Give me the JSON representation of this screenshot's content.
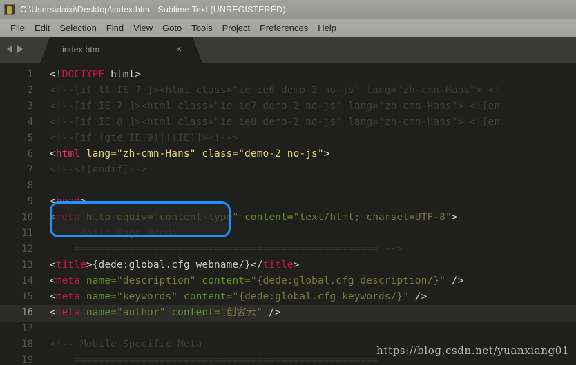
{
  "window": {
    "title": "C:\\Users\\daixi\\Desktop\\index.htm - Sublime Text (UNREGISTERED)",
    "icon": "sublime-text-icon"
  },
  "menubar": {
    "items": [
      {
        "label": "File"
      },
      {
        "label": "Edit"
      },
      {
        "label": "Selection"
      },
      {
        "label": "Find"
      },
      {
        "label": "View"
      },
      {
        "label": "Goto"
      },
      {
        "label": "Tools"
      },
      {
        "label": "Project"
      },
      {
        "label": "Preferences"
      },
      {
        "label": "Help"
      }
    ]
  },
  "tabbar": {
    "prev_icon": "arrow-left-icon",
    "next_icon": "arrow-right-icon",
    "tab": {
      "label": "index.htm",
      "close_label": "×"
    }
  },
  "editor": {
    "active_line": 16,
    "highlight_color": "#1e90ff",
    "lines": [
      {
        "num": "1",
        "segments": [
          {
            "t": "<!",
            "c": "c-punct"
          },
          {
            "t": "DOCTYPE",
            "c": "c-doctype"
          },
          {
            "t": " html>",
            "c": "c-punct"
          }
        ]
      },
      {
        "num": "2",
        "segments": [
          {
            "t": "<!--[if lt IE 7 ]><html class=\"ie ie6 demo-2 no-js\" lang=\"zh-cmn-Hans\"> <!",
            "c": "c-comment"
          }
        ]
      },
      {
        "num": "3",
        "segments": [
          {
            "t": "<!--[if IE 7 ]><html class=\"ie ie7 demo-2 no-js\" lang=\"zh-cmn-Hans\"> <![en",
            "c": "c-comment"
          }
        ]
      },
      {
        "num": "4",
        "segments": [
          {
            "t": "<!--[if IE 8 ]><html class=\"ie ie8 demo-2 no-js\" lang=\"zh-cmn-Hans\"> <![en",
            "c": "c-comment"
          }
        ]
      },
      {
        "num": "5",
        "segments": [
          {
            "t": "<!--[if (gte IE 9)|!(IE)]><!-->",
            "c": "c-comment"
          }
        ]
      },
      {
        "num": "6",
        "highlighted": true,
        "segments": [
          {
            "t": "<",
            "c": "c-punct"
          },
          {
            "t": "html",
            "c": "c-tag"
          },
          {
            "t": " lang=",
            "c": "c-attr"
          },
          {
            "t": "\"zh-cmn-Hans\"",
            "c": "c-string"
          },
          {
            "t": " class=",
            "c": "c-attr"
          },
          {
            "t": "\"demo-2 no-js\"",
            "c": "c-string"
          },
          {
            "t": ">",
            "c": "c-punct"
          }
        ]
      },
      {
        "num": "7",
        "segments": [
          {
            "t": "<!--<![endif]-->",
            "c": "c-comment"
          }
        ]
      },
      {
        "num": "8",
        "segments": []
      },
      {
        "num": "9",
        "segments": [
          {
            "t": "<",
            "c": "c-punct"
          },
          {
            "t": "head",
            "c": "c-tag"
          },
          {
            "t": ">",
            "c": "c-punct"
          }
        ]
      },
      {
        "num": "10",
        "segments": [
          {
            "t": "<",
            "c": "c-punct"
          },
          {
            "t": "meta",
            "c": "c-tag"
          },
          {
            "t": " http-equiv=",
            "c": "c-attr"
          },
          {
            "t": "\"content-type\"",
            "c": "c-string"
          },
          {
            "t": " content=",
            "c": "c-attr"
          },
          {
            "t": "\"text/html; charset=UTF-8\"",
            "c": "c-string"
          },
          {
            "t": ">",
            "c": "c-punct"
          }
        ]
      },
      {
        "num": "11",
        "segments": [
          {
            "t": "<!-- Basic Page Needs",
            "c": "c-comment"
          }
        ]
      },
      {
        "num": "12",
        "segments": [
          {
            "t": "    ================================================== -->",
            "c": "c-comment"
          }
        ]
      },
      {
        "num": "13",
        "segments": [
          {
            "t": "<",
            "c": "c-punct"
          },
          {
            "t": "title",
            "c": "c-tag"
          },
          {
            "t": ">",
            "c": "c-punct"
          },
          {
            "t": "{dede:global.cfg_webname/}",
            "c": "c-plain"
          },
          {
            "t": "</",
            "c": "c-punct"
          },
          {
            "t": "title",
            "c": "c-tag"
          },
          {
            "t": ">",
            "c": "c-punct"
          }
        ]
      },
      {
        "num": "14",
        "segments": [
          {
            "t": "<",
            "c": "c-punct"
          },
          {
            "t": "meta",
            "c": "c-tag"
          },
          {
            "t": " name=",
            "c": "c-attr"
          },
          {
            "t": "\"description\"",
            "c": "c-string"
          },
          {
            "t": " content=",
            "c": "c-attr"
          },
          {
            "t": "\"{dede:global.cfg_description/}\"",
            "c": "c-string"
          },
          {
            "t": " />",
            "c": "c-punct"
          }
        ]
      },
      {
        "num": "15",
        "segments": [
          {
            "t": "<",
            "c": "c-punct"
          },
          {
            "t": "meta",
            "c": "c-tag"
          },
          {
            "t": " name=",
            "c": "c-attr"
          },
          {
            "t": "\"keywords\"",
            "c": "c-string"
          },
          {
            "t": " content=",
            "c": "c-attr"
          },
          {
            "t": "\"{dede:global.cfg_keywords/}\"",
            "c": "c-string"
          },
          {
            "t": " />",
            "c": "c-punct"
          }
        ]
      },
      {
        "num": "16",
        "active": true,
        "segments": [
          {
            "t": "<",
            "c": "c-punct"
          },
          {
            "t": "meta",
            "c": "c-tag"
          },
          {
            "t": " name=",
            "c": "c-attr"
          },
          {
            "t": "\"author\"",
            "c": "c-string"
          },
          {
            "t": " content=",
            "c": "c-attr"
          },
          {
            "t": "\"创客云\"",
            "c": "c-string"
          },
          {
            "t": " />",
            "c": "c-punct"
          }
        ]
      },
      {
        "num": "17",
        "segments": []
      },
      {
        "num": "18",
        "segments": [
          {
            "t": "<!-- Mobile Specific Meta",
            "c": "c-comment"
          }
        ]
      },
      {
        "num": "19",
        "segments": [
          {
            "t": "    ==================================================",
            "c": "c-comment"
          }
        ]
      }
    ]
  },
  "watermark": {
    "text": "https://blog.csdn.net/yuanxiang01"
  }
}
